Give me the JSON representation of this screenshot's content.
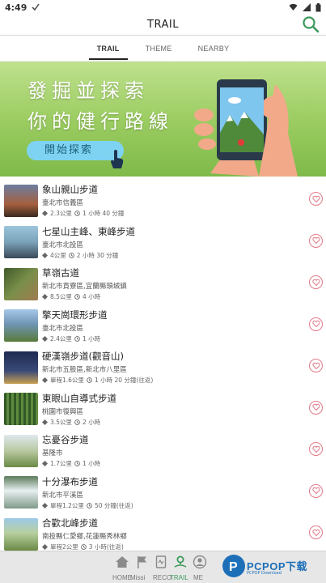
{
  "status_bar": {
    "time": "4:49"
  },
  "header": {
    "title": "TRAIL"
  },
  "tabs": [
    {
      "label": "TRAIL",
      "active": true
    },
    {
      "label": "THEME",
      "active": false
    },
    {
      "label": "NEARBY",
      "active": false
    }
  ],
  "banner": {
    "line1": "發掘並探索",
    "line2": "你的健行路線",
    "cta": "開始探索"
  },
  "trails": [
    {
      "name": "象山親山步道",
      "area": "臺北市信義區",
      "distance": "2.3公里",
      "time": "1 小時 40 分鐘",
      "thumb": "#a5603f"
    },
    {
      "name": "七星山主峰、東峰步道",
      "area": "臺北市北投區",
      "distance": "4公里",
      "time": "2 小時 30 分鐘",
      "thumb": "#7aa2b8"
    },
    {
      "name": "草嶺古道",
      "area": "新北市貢寮區,宜蘭縣頭城鎮",
      "distance": "8.5公里",
      "time": "4 小時",
      "thumb": "#5f7a3c"
    },
    {
      "name": "擎天崗環形步道",
      "area": "臺北市北投區",
      "distance": "2.4公里",
      "time": "1 小時",
      "thumb": "#6f95b5"
    },
    {
      "name": "硬漢嶺步道(觀音山)",
      "area": "新北市五股區,新北市八里區",
      "distance": "單程1.6公里",
      "time": "1 小時 20 分鐘(往返)",
      "thumb": "#2f3f6a"
    },
    {
      "name": "東眼山自導式步道",
      "area": "桃園市復興區",
      "distance": "3.5公里",
      "time": "2 小時",
      "thumb": "#3f6a30"
    },
    {
      "name": "忘憂谷步道",
      "area": "基隆市",
      "distance": "1.7公里",
      "time": "1 小時",
      "thumb": "#8aa36a"
    },
    {
      "name": "十分瀑布步道",
      "area": "新北市平溪區",
      "distance": "單程1.2公里",
      "time": "50 分鐘(往返)",
      "thumb": "#7f9a8a"
    },
    {
      "name": "合歡北峰步道",
      "area": "南投縣仁愛鄉,花蓮縣秀林鄉",
      "distance": "單程2公里",
      "time": "3 小時(往返)",
      "thumb": "#6a8a45"
    }
  ],
  "bottom_nav": [
    {
      "label": "HOME",
      "icon": "home-icon",
      "active": false
    },
    {
      "label": "Missi",
      "icon": "flag-icon",
      "active": false
    },
    {
      "label": "RECO",
      "icon": "record-icon",
      "active": false
    },
    {
      "label": "TRAIL",
      "icon": "map-pin-icon",
      "active": true
    },
    {
      "label": "ME",
      "icon": "person-icon",
      "active": false
    }
  ],
  "watermark": {
    "text": "PCPOP下载",
    "sub": "PCPOP Download"
  },
  "colors": {
    "banner_green": "#9ccd62",
    "accent_green": "#3a9a5a",
    "heart": "#e07a88"
  }
}
